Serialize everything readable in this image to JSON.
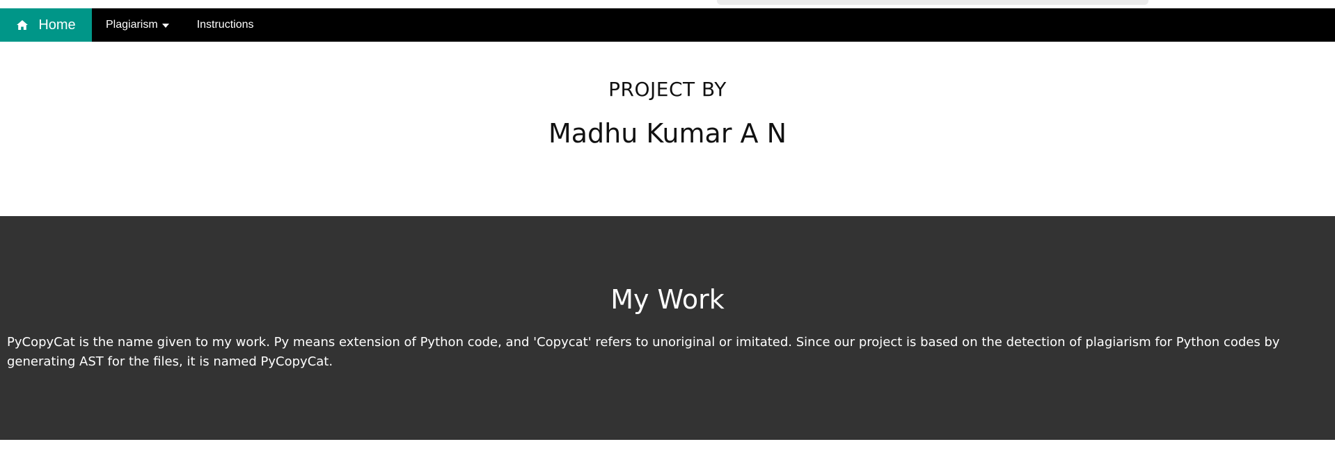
{
  "navbar": {
    "home_label": "Home",
    "home_icon": "home-icon",
    "plagiarism_label": "Plagiarism",
    "plagiarism_icon": "caret-down-icon",
    "instructions_label": "Instructions",
    "colors": {
      "background": "#000000",
      "home_active": "#009688",
      "text": "#ffffff"
    }
  },
  "hero": {
    "project_by": "PROJECT BY",
    "author": "Madhu Kumar A N"
  },
  "work": {
    "title": "My Work",
    "description": "PyCopyCat is the name given to my work. Py means extension of Python code, and 'Copycat' refers to unoriginal or imitated. Since our project is based on the detection of plagiarism for Python codes by generating AST for the files, it is named PyCopyCat.",
    "colors": {
      "background": "#333333",
      "text": "#ffffff"
    }
  }
}
